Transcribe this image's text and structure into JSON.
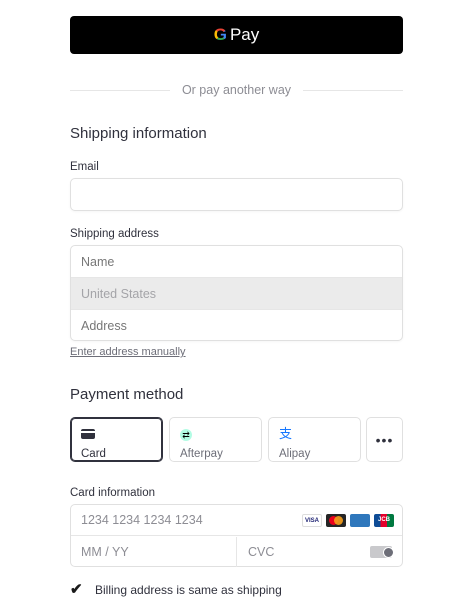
{
  "gpay": {
    "g": "G",
    "pay": "Pay"
  },
  "divider_text": "Or pay another way",
  "shipping": {
    "title": "Shipping information",
    "email_label": "Email",
    "email_value": "",
    "address_label": "Shipping address",
    "name_placeholder": "Name",
    "country_value": "United States",
    "address_placeholder": "Address",
    "manual_link": "Enter address manually"
  },
  "payment": {
    "title": "Payment method",
    "methods": [
      {
        "label": "Card",
        "icon": "card-icon",
        "selected": true
      },
      {
        "label": "Afterpay",
        "icon": "afterpay-icon",
        "selected": false
      },
      {
        "label": "Alipay",
        "icon": "alipay-icon",
        "selected": false
      }
    ],
    "more": "•••"
  },
  "card": {
    "label": "Card information",
    "number_placeholder": "1234 1234 1234 1234",
    "brands": [
      "VISA",
      "Mastercard",
      "AMEX",
      "JCB"
    ],
    "expiry_placeholder": "MM / YY",
    "cvc_placeholder": "CVC"
  },
  "billing": {
    "checked": true,
    "label": "Billing address is same as shipping"
  }
}
